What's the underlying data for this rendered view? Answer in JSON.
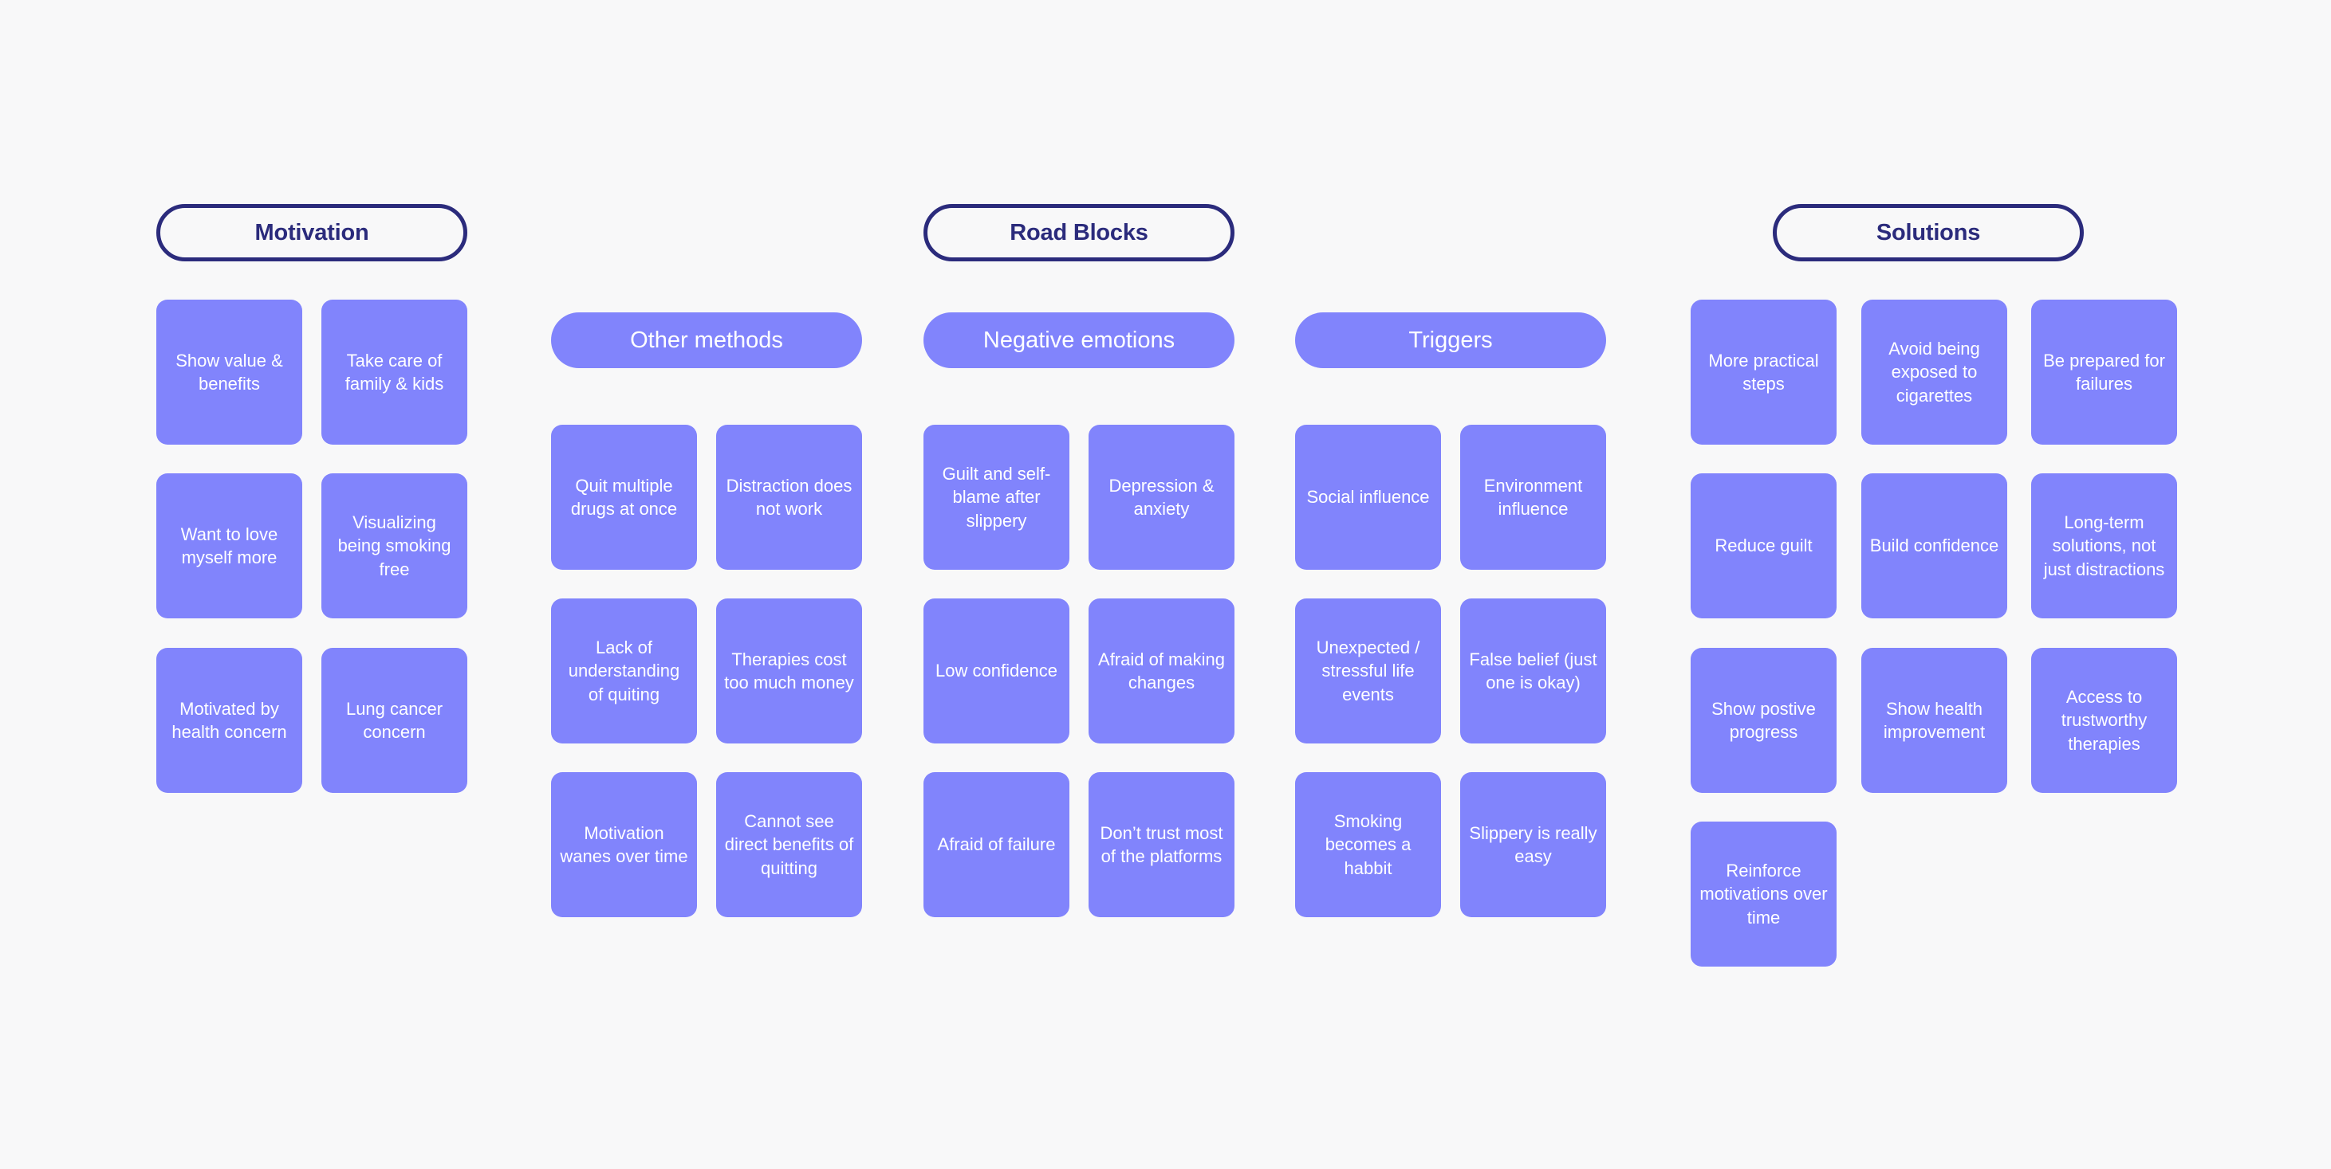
{
  "canvas": {
    "background_color": "#f8f8f9",
    "card_color": "#8184fc",
    "accent_color": "#2b2b7c",
    "card_text_color": "#ffffff"
  },
  "categories": [
    {
      "id": "motivation",
      "label": "Motivation",
      "groups": [
        {
          "id": "motivation-main",
          "label": null,
          "cards": [
            "Show value & benefits",
            "Take care of family & kids",
            "Want to love myself more",
            "Visualizing being smoking free",
            "Motivated by health concern",
            "Lung cancer concern"
          ]
        }
      ]
    },
    {
      "id": "road-blocks",
      "label": "Road Blocks",
      "groups": [
        {
          "id": "other-methods",
          "label": "Other methods",
          "cards": [
            "Quit multiple drugs at once",
            "Distraction does not work",
            "Lack of understanding of quiting",
            "Therapies cost too much money",
            "Motivation wanes over time",
            "Cannot see direct benefits of quitting"
          ]
        },
        {
          "id": "negative-emotions",
          "label": "Negative emotions",
          "cards": [
            "Guilt and self-blame after slippery",
            "Depression & anxiety",
            "Low confidence",
            "Afraid of making changes",
            "Afraid of failure",
            "Don’t trust most of the platforms"
          ]
        },
        {
          "id": "triggers",
          "label": "Triggers",
          "cards": [
            "Social influence",
            "Environment influence",
            "Unexpected / stressful life events",
            "False belief (just one is okay)",
            "Smoking becomes a habbit",
            "Slippery is really easy"
          ]
        }
      ]
    },
    {
      "id": "solutions",
      "label": "Solutions",
      "groups": [
        {
          "id": "solutions-main",
          "label": null,
          "cards": [
            "More practical steps",
            "Avoid being exposed to cigarettes",
            "Be prepared for failures",
            "Reduce guilt",
            "Build confidence",
            "Long-term solutions, not just distractions",
            "Show postive progress",
            "Show health improvement",
            "Access to trustworthy therapies",
            "Reinforce motivations over time"
          ]
        }
      ]
    }
  ]
}
